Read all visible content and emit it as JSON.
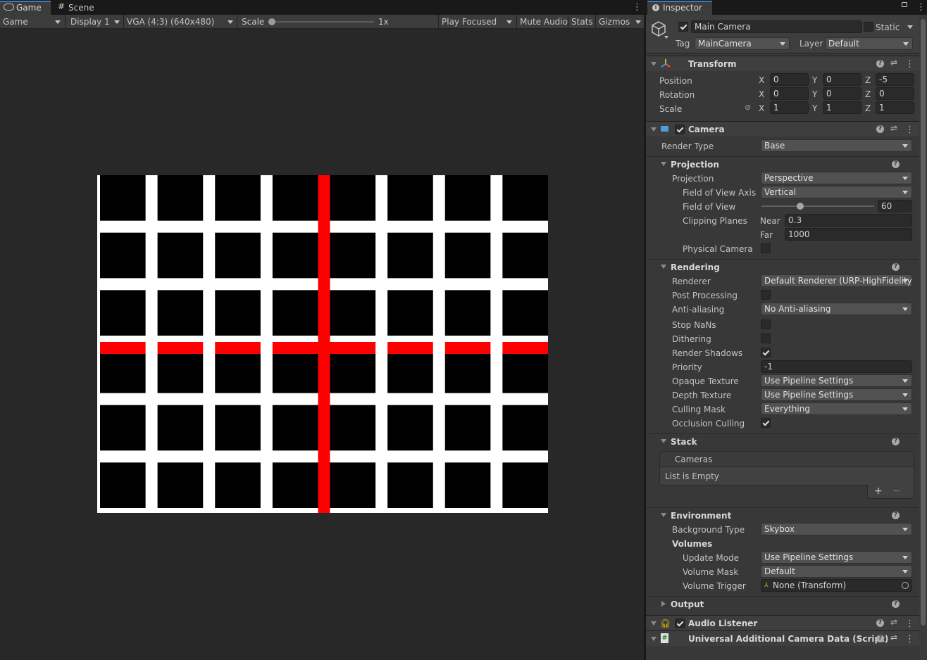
{
  "game_view": {
    "tabs": [
      {
        "label": "Game",
        "icon": "gamepad-icon"
      },
      {
        "label": "Scene",
        "icon": "grid-icon"
      }
    ],
    "toolbar": {
      "mode": "Game",
      "display": "Display 1",
      "resolution": "VGA (4:3) (640x480)",
      "scale_label": "Scale",
      "scale_value": "1x",
      "scale_fraction": 0.0,
      "play_mode": "Play Focused",
      "mute_audio": "Mute Audio",
      "stats": "Stats",
      "gizmos": "Gizmos"
    },
    "render": {
      "background_color": "#ffffff",
      "cell_color": "#000000",
      "highlight_color": "#ff0000",
      "columns": 8,
      "rows": 6,
      "highlight_column_line": 4,
      "highlight_row_line": 3
    }
  },
  "inspector": {
    "tab_label": "Inspector",
    "object": {
      "active": true,
      "name": "Main Camera",
      "static_label": "Static",
      "tag_label": "Tag",
      "tag_value": "MainCamera",
      "layer_label": "Layer",
      "layer_value": "Default"
    },
    "transform": {
      "title": "Transform",
      "position": {
        "label": "Position",
        "x": "0",
        "y": "0",
        "z": "-5"
      },
      "rotation": {
        "label": "Rotation",
        "x": "0",
        "y": "0",
        "z": "0"
      },
      "scale": {
        "label": "Scale",
        "x": "1",
        "y": "1",
        "z": "1"
      },
      "axis_x": "X",
      "axis_y": "Y",
      "axis_z": "Z"
    },
    "camera": {
      "title": "Camera",
      "enabled": true,
      "render_type_label": "Render Type",
      "render_type": "Base",
      "projection_section": "Projection",
      "projection_label": "Projection",
      "projection": "Perspective",
      "fov_axis_label": "Field of View Axis",
      "fov_axis": "Vertical",
      "fov_label": "Field of View",
      "fov_value": "60",
      "fov_fraction": 0.333,
      "clipping_label": "Clipping Planes",
      "near_label": "Near",
      "near_value": "0.3",
      "far_label": "Far",
      "far_value": "1000",
      "physical_camera_label": "Physical Camera",
      "physical_camera": false,
      "rendering_section": "Rendering",
      "renderer_label": "Renderer",
      "renderer": "Default Renderer (URP-HighFidelity",
      "post_processing_label": "Post Processing",
      "post_processing": false,
      "anti_aliasing_label": "Anti-aliasing",
      "anti_aliasing": "No Anti-aliasing",
      "stop_nans_label": "Stop NaNs",
      "stop_nans": false,
      "dithering_label": "Dithering",
      "dithering": false,
      "render_shadows_label": "Render Shadows",
      "render_shadows": true,
      "priority_label": "Priority",
      "priority": "-1",
      "opaque_texture_label": "Opaque Texture",
      "opaque_texture": "Use Pipeline Settings",
      "depth_texture_label": "Depth Texture",
      "depth_texture": "Use Pipeline Settings",
      "culling_mask_label": "Culling Mask",
      "culling_mask": "Everything",
      "occlusion_culling_label": "Occlusion Culling",
      "occlusion_culling": true,
      "stack_section": "Stack",
      "cameras_header": "Cameras",
      "list_empty": "List is Empty",
      "environment_section": "Environment",
      "background_type_label": "Background Type",
      "background_type": "Skybox",
      "volumes_label": "Volumes",
      "update_mode_label": "Update Mode",
      "update_mode": "Use Pipeline Settings",
      "volume_mask_label": "Volume Mask",
      "volume_mask": "Default",
      "volume_trigger_label": "Volume Trigger",
      "volume_trigger": "None (Transform)",
      "output_section": "Output"
    },
    "audio_listener": {
      "title": "Audio Listener",
      "enabled": true
    },
    "additional_data": {
      "title": "Universal Additional Camera Data (Script)"
    },
    "colors": {
      "accent": "#3a79bb",
      "panel": "#383838",
      "field": "#2a2a2a"
    }
  }
}
